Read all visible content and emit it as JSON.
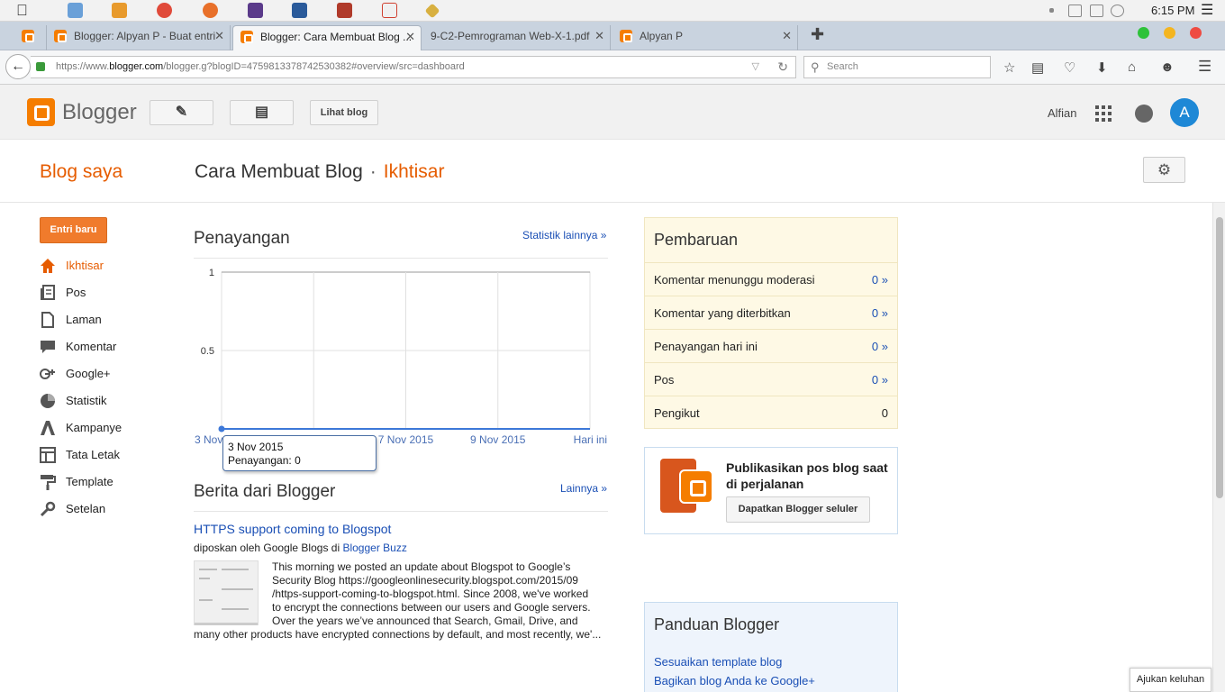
{
  "os": {
    "time": "6:15 PM"
  },
  "browser": {
    "tabs": [
      {
        "label": ""
      },
      {
        "label": "Blogger: Alpyan P - Buat entri"
      },
      {
        "label": "Blogger: Cara Membuat Blog ..."
      },
      {
        "label": "9-C2-Pemrograman Web-X-1.pdf"
      },
      {
        "label": "Alpyan P"
      }
    ],
    "url_prefix": "https://www.",
    "url_host": "blogger.com",
    "url_rest": "/blogger.g?blogID=4759813378742530382#overview/src=dashboard",
    "search_placeholder": "Search"
  },
  "header": {
    "brand": "Blogger",
    "view_blog_label": "Lihat blog",
    "user_name": "Alfian",
    "avatar_initial": "A"
  },
  "titlebar": {
    "my_blog": "Blog saya",
    "blog_name": "Cara Membuat Blog",
    "separator": "·",
    "section": "Ikhtisar"
  },
  "sidebar": {
    "new_post": "Entri baru",
    "items": [
      {
        "label": "Ikhtisar",
        "icon": "home-icon"
      },
      {
        "label": "Pos",
        "icon": "posts-icon"
      },
      {
        "label": "Laman",
        "icon": "page-icon"
      },
      {
        "label": "Komentar",
        "icon": "comment-icon"
      },
      {
        "label": "Google+",
        "icon": "google-plus-icon"
      },
      {
        "label": "Statistik",
        "icon": "pie-chart-icon"
      },
      {
        "label": "Kampanye",
        "icon": "campaign-icon"
      },
      {
        "label": "Tata Letak",
        "icon": "layout-icon"
      },
      {
        "label": "Template",
        "icon": "paint-roller-icon"
      },
      {
        "label": "Setelan",
        "icon": "wrench-icon"
      }
    ]
  },
  "views": {
    "title": "Penayangan",
    "more_stats": "Statistik lainnya »",
    "tooltip_date": "3 Nov 2015",
    "tooltip_value": "Penayangan: 0"
  },
  "chart_data": {
    "type": "line",
    "x": [
      "3 Nov 2015",
      "5 Nov 2015",
      "7 Nov 2015",
      "9 Nov 2015",
      "Hari ini"
    ],
    "x_tick_labels": [
      "3 Nov",
      "",
      "7 Nov 2015",
      "9 Nov 2015",
      "Hari ini"
    ],
    "series": [
      {
        "values": [
          0,
          0,
          0,
          0,
          0
        ]
      }
    ],
    "y_ticks": [
      "1",
      "0.5"
    ],
    "ylim": [
      0,
      1
    ],
    "grid": true,
    "colors": {
      "line": "#3d78d8",
      "grid": "#e0e0e0",
      "tick": "#4a6fb5"
    }
  },
  "news": {
    "title": "Berita dari Blogger",
    "more_link": "Lainnya »",
    "post_title": "HTTPS support coming to Blogspot",
    "byline_prefix": "diposkan oleh Google Blogs di ",
    "byline_link": "Blogger Buzz",
    "body_lines": [
      "This morning we posted an update about Blogspot to Google’s",
      "Security Blog https://googleonlinesecurity.blogspot.com/2015/09",
      "/https-support-coming-to-blogspot.html. Since 2008, we've worked",
      "to encrypt the connections between our users and Google servers.",
      "Over the years we’ve announced that Search, Gmail, Drive, and"
    ],
    "body_last": "many other products have encrypted connections by default, and most recently, we'..."
  },
  "updates": {
    "title": "Pembaruan",
    "rows": [
      {
        "label": "Komentar menunggu moderasi",
        "value": "0 »"
      },
      {
        "label": "Komentar yang diterbitkan",
        "value": "0 »"
      },
      {
        "label": "Penayangan hari ini",
        "value": "0 »"
      },
      {
        "label": "Pos",
        "value": "0 »"
      },
      {
        "label": "Pengikut",
        "value": "0"
      }
    ]
  },
  "mobile": {
    "text": "Publikasikan pos blog saat di perjalanan",
    "button": "Dapatkan Blogger seluler"
  },
  "guide": {
    "title": "Panduan Blogger",
    "links": [
      "Sesuaikan template blog",
      "Bagikan blog Anda ke Google+"
    ]
  },
  "feedback": "Ajukan keluhan",
  "colors": {
    "accent": "#e65c00",
    "brand": "#f57d00",
    "link": "#1a4fb5",
    "updates_bg": "#fef9e5",
    "guide_bg": "#eef4fc"
  }
}
